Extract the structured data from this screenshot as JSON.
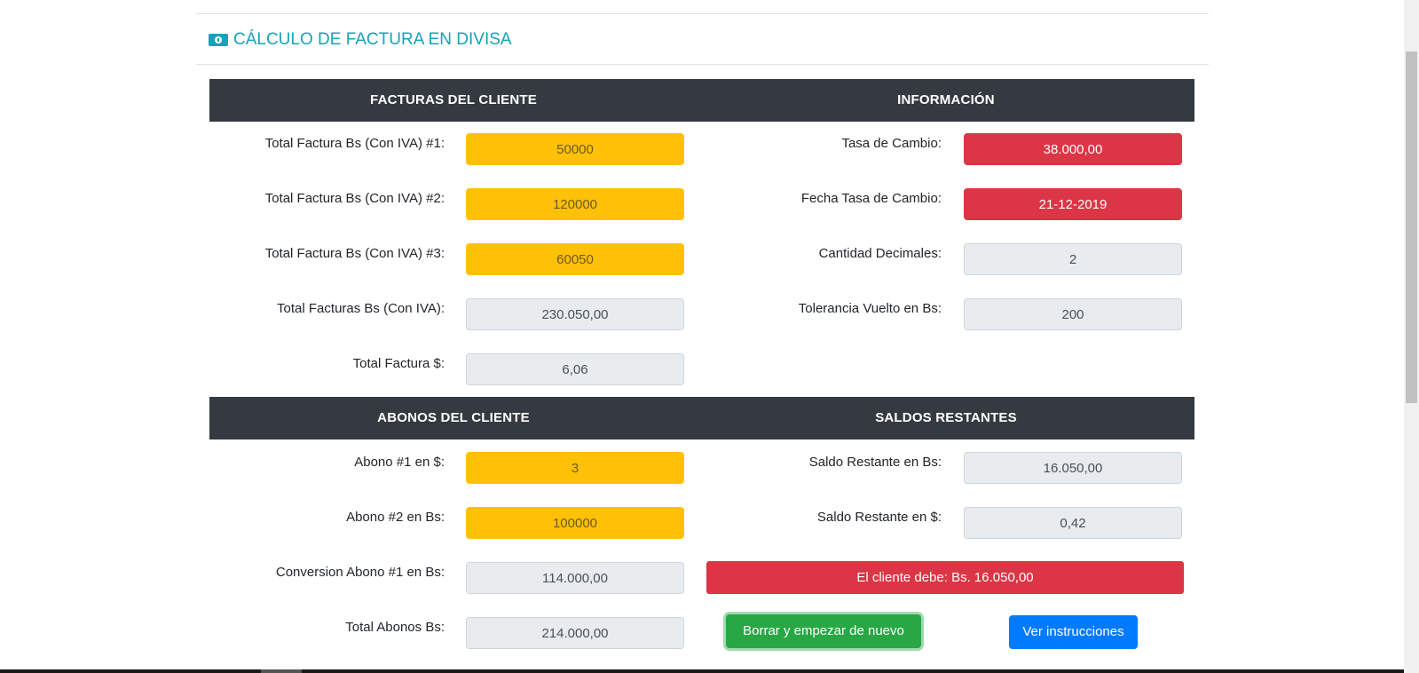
{
  "title": "CÁLCULO DE FACTURA EN DIVISA",
  "icons": {
    "title_icon": "money-bill-icon"
  },
  "colors": {
    "accent": "#17a2b8",
    "header_bg": "#343a40",
    "warning": "#ffc107",
    "danger": "#dc3545",
    "success": "#28a745",
    "primary": "#007bff",
    "readonly": "#e9ecef"
  },
  "section1": {
    "left_header": "FACTURAS DEL CLIENTE",
    "right_header": "INFORMACIÓN",
    "left_rows": [
      {
        "label": "Total Factura Bs (Con IVA) #1:",
        "value": "50000"
      },
      {
        "label": "Total Factura Bs (Con IVA) #2:",
        "value": "120000"
      },
      {
        "label": "Total Factura Bs (Con IVA) #3:",
        "value": "60050"
      },
      {
        "label": "Total Facturas Bs (Con IVA):",
        "value": "230.050,00"
      },
      {
        "label": "Total Factura $:",
        "value": "6,06"
      }
    ],
    "right_rows": [
      {
        "label": "Tasa de Cambio:",
        "value": "38.000,00"
      },
      {
        "label": "Fecha Tasa de Cambio:",
        "value": "21-12-2019"
      },
      {
        "label": "Cantidad Decimales:",
        "value": "2"
      },
      {
        "label": "Tolerancia Vuelto en Bs:",
        "value": "200"
      }
    ]
  },
  "section2": {
    "left_header": "ABONOS DEL CLIENTE",
    "right_header": "SALDOS RESTANTES",
    "left_rows": [
      {
        "label": "Abono #1 en $:",
        "value": "3"
      },
      {
        "label": "Abono #2 en Bs:",
        "value": "100000"
      },
      {
        "label": "Conversion Abono #1 en Bs:",
        "value": "114.000,00"
      },
      {
        "label": "Total Abonos Bs:",
        "value": "214.000,00"
      }
    ],
    "right_rows": [
      {
        "label": "Saldo Restante en Bs:",
        "value": "16.050,00"
      },
      {
        "label": "Saldo Restante en $:",
        "value": "0,42"
      }
    ],
    "alert": "El cliente debe: Bs. 16.050,00"
  },
  "buttons": {
    "reset": "Borrar y empezar de nuevo",
    "instructions": "Ver instrucciones"
  }
}
